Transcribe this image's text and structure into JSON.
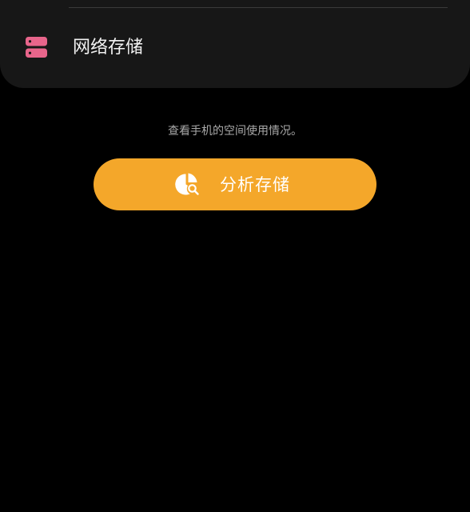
{
  "storage_list": {
    "network_storage": {
      "label": "网络存储",
      "icon": "network-storage-icon",
      "icon_color": "#e8658b"
    }
  },
  "analysis": {
    "hint": "查看手机的空间使用情况。",
    "button_label": "分析存储",
    "button_icon": "storage-analysis-icon",
    "accent_color": "#f4a72a"
  }
}
